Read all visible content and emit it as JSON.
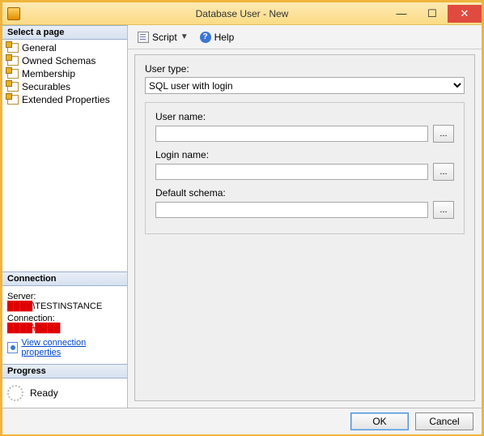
{
  "window": {
    "title": "Database User - New"
  },
  "leftpanel": {
    "select_page_header": "Select a page",
    "pages": [
      {
        "label": "General"
      },
      {
        "label": "Owned Schemas"
      },
      {
        "label": "Membership"
      },
      {
        "label": "Securables"
      },
      {
        "label": "Extended Properties"
      }
    ],
    "connection_header": "Connection",
    "connection": {
      "server_label": "Server:",
      "server_value": "\\TESTINSTANCE",
      "server_redacted_prefix": "████",
      "connection_label": "Connection:",
      "connection_value": "████\\████",
      "view_props": "View connection properties"
    },
    "progress_header": "Progress",
    "progress_status": "Ready"
  },
  "toolbar": {
    "script_label": "Script",
    "help_label": "Help"
  },
  "form": {
    "user_type_label": "User type:",
    "user_type_value": "SQL user with login",
    "user_name_label": "User name:",
    "user_name_value": "",
    "login_name_label": "Login name:",
    "login_name_value": "",
    "default_schema_label": "Default schema:",
    "default_schema_value": "",
    "browse": "..."
  },
  "footer": {
    "ok": "OK",
    "cancel": "Cancel"
  }
}
